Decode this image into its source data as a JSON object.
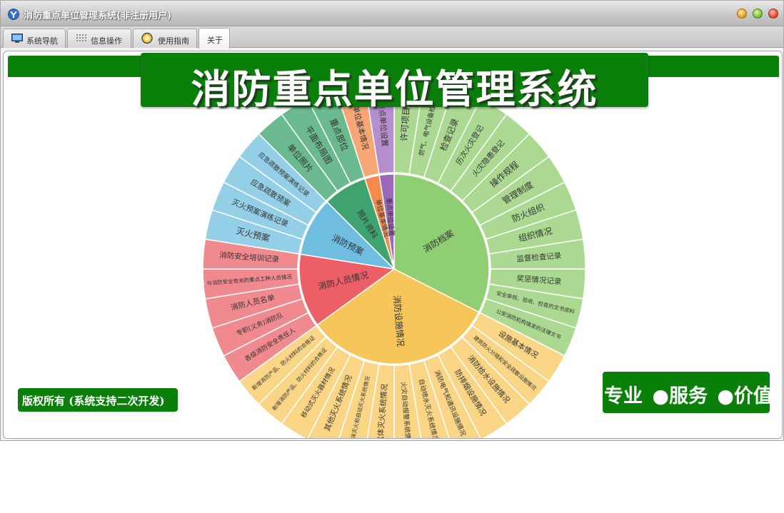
{
  "window": {
    "title": "消防重点单位管理系统(非注册用户)"
  },
  "tabs": [
    {
      "label": "系统导航",
      "icon": "monitor-icon"
    },
    {
      "label": "信息操作",
      "icon": "grid-icon"
    },
    {
      "label": "使用指南",
      "icon": "guide-icon"
    },
    {
      "label": "关于",
      "icon": ""
    }
  ],
  "banner": {
    "title": "消防重点单位管理系统"
  },
  "footer": {
    "copyright": "版权所有 (系统支持二次开发)",
    "slogan": [
      "专业",
      "●服务",
      "●价值"
    ]
  },
  "colors": {
    "brand_green": "#0a7f0a",
    "archives": "#8fce72",
    "facilities": "#f7c65a",
    "personnel": "#ec5f67",
    "plans": "#6fbde0",
    "photos": "#3fa36f",
    "basic": "#f38b4e",
    "settings": "#9a6ab8"
  },
  "chart_data": {
    "type": "sunburst",
    "start_angle_deg": 0,
    "categories": [
      {
        "name": "消防档案",
        "color": "#8fce72",
        "outer_color": "#acd991",
        "children": [
          "许可项目",
          "燃气、电气设备检测",
          "检查记录",
          "历次火灾登记",
          "火灾隐患登记",
          "操作规程",
          "管理制度",
          "防火组织",
          "组织情况",
          "监督检查记录",
          "奖惩情况记录",
          "安全审核、验收、检查的文书资料",
          "公安消防机构填发的法律文书"
        ]
      },
      {
        "name": "消防设施情况",
        "color": "#f7c65a",
        "outer_color": "#fad585",
        "children": [
          "设施基本情况",
          "建筑防火分隔和安全疏散设施情况",
          "消防给水设施情况",
          "防排烟设施情况",
          "消防电气和通讯设施情况",
          "自动喷水灭火系统情况",
          "火灾自动报警系统情况",
          "气体灭火系统情况",
          "泡沫灭火和自动灭火系统情况",
          "其他灭火系统情况",
          "移动式灭火器材情况",
          "新增消防产品、防火材料的合格证",
          "新增消防产品、防火材料的合格证"
        ]
      },
      {
        "name": "消防人员情况",
        "color": "#ec5f67",
        "outer_color": "#f08a8f",
        "children": [
          "各级消防安全责任人",
          "专职(义务)消防队",
          "消防人员名单",
          "与消防安全有关的重点工种人员情况",
          "消防安全培训记录"
        ]
      },
      {
        "name": "消防预案",
        "color": "#6fbde0",
        "outer_color": "#94cfe8",
        "children": [
          "灭火预案",
          "灭火预案演练记录",
          "应急疏散预案",
          "应急疏散预案演练记录"
        ]
      },
      {
        "name": "照片资料",
        "color": "#3fa36f",
        "outer_color": "#6bba8f",
        "children": [
          "单位照片",
          "平面布局图",
          "重点部位"
        ]
      },
      {
        "name": "单位基本情况",
        "color": "#f38b4e",
        "outer_color": "#f7a676",
        "children": [
          "单位基本情况"
        ]
      },
      {
        "name": "重点单位设置",
        "color": "#9a6ab8",
        "outer_color": "#b58fcc",
        "children": [
          "重点单位设置"
        ]
      }
    ]
  }
}
